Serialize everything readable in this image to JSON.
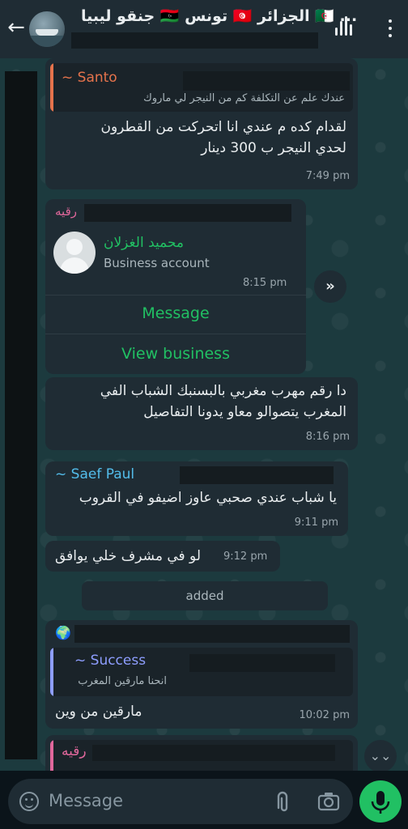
{
  "header": {
    "title": "جنقو ليبيا 🇱🇾 تونس 🇹🇳 الجزائر 🇩🇿 ..."
  },
  "messages": {
    "m1": {
      "quote_name": "~ Santo",
      "quote_text": "عندك علم عن التكلفة كم من النيجر لي ماروك",
      "line1": "لقدام كده م عندي انا اتحركت من القطرون",
      "line2": "لحدي النيجر ب 300 دينار",
      "time": "7:49 pm"
    },
    "m2": {
      "sender": "رقيه",
      "contact_name": "محميد الغزلان",
      "contact_sub": "Business account",
      "time": "8:15 pm",
      "action1": "Message",
      "action2": "View business"
    },
    "m3": {
      "line1": "دا رقم مهرب مغربي بالبسنبك الشباب الفي",
      "line2": "المغرب يتصوالو معاو يدونا التفاصيل",
      "time": "8:16 pm"
    },
    "m4": {
      "sender": "~ Saef Paul",
      "line1": "يا شباب عندي صحبي عاوز اضيفو في القروب",
      "time": "9:11 pm"
    },
    "m5": {
      "line1": "لو في مشرف خلي يوافق",
      "time": "9:12 pm"
    },
    "system": "added",
    "m6": {
      "globe": "🌍",
      "quote_name": "~ Success",
      "quote_text": "انحنا مارقين المغرب",
      "line1": "مارقين من وين",
      "time": "10:02 pm"
    },
    "m7": {
      "quote_name": "رقيه"
    }
  },
  "composer": {
    "placeholder": "Message"
  },
  "colors": {
    "accent_green": "#21c063",
    "santo": "#e5734c",
    "ruqaya": "#e0679b",
    "saef": "#53bdeb",
    "success": "#8e9eff"
  }
}
